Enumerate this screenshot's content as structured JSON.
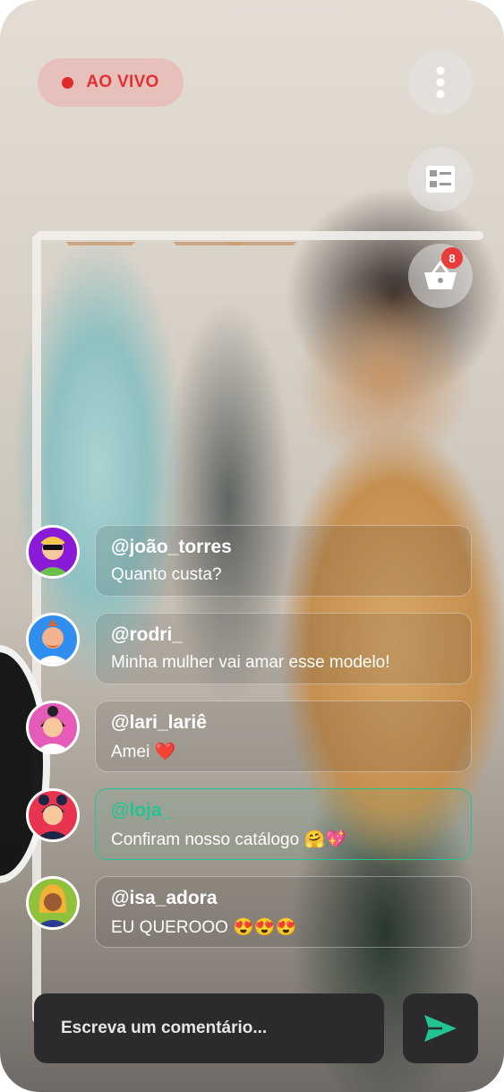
{
  "live": {
    "label": "AO VIVO"
  },
  "header": {
    "menu_icon": "more-vertical-icon",
    "catalog_icon": "catalog-list-icon",
    "cart_icon": "shopping-basket-icon",
    "cart_count": "8"
  },
  "comments": [
    {
      "user": "@joão_torres",
      "text": "Quanto custa?",
      "avatar_bg": "#8a1ad8"
    },
    {
      "user": "@rodri_",
      "text": "Minha mulher vai amar esse modelo!",
      "avatar_bg": "#2f8ef0"
    },
    {
      "user": "@lari_lariê",
      "text": "Amei ❤️",
      "avatar_bg": "#e65bb8"
    },
    {
      "user": "@loja_",
      "text": "Confiram nosso catálogo 🤗💖",
      "avatar_bg": "#e8344f"
    },
    {
      "user": "@isa_adora",
      "text": "EU QUEROOO 😍😍😍",
      "avatar_bg": "#8fc23a"
    }
  ],
  "composer": {
    "placeholder": "Escreva um comentário...",
    "send_icon": "send-icon"
  },
  "colors": {
    "accent": "#22c493",
    "live_red": "#e12b2b",
    "badge_red": "#ea3b3b"
  }
}
